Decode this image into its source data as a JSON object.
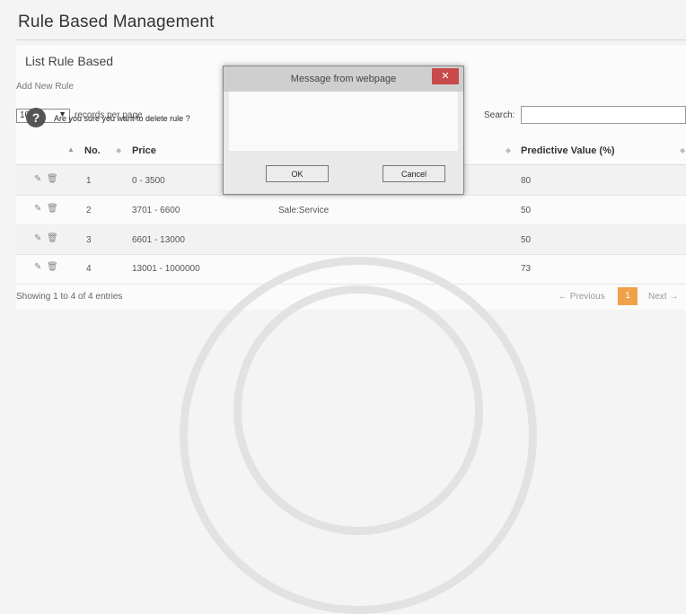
{
  "page": {
    "title": "Rule Based Management"
  },
  "panel": {
    "heading": "List Rule Based",
    "add_link": "Add New Rule"
  },
  "table_controls": {
    "length_value": "10",
    "length_label": "records per page",
    "search_label": "Search:"
  },
  "table": {
    "headers": {
      "no": "No.",
      "price": "Price",
      "predictive": "Predictive Value (%)"
    },
    "rows": [
      {
        "no": "1",
        "price": "0 - 3500",
        "rule": "",
        "predictive": "80"
      },
      {
        "no": "2",
        "price": "3701 - 6600",
        "rule": "Sale:Service",
        "predictive": "50"
      },
      {
        "no": "3",
        "price": "6601 - 13000",
        "rule": "",
        "predictive": "50"
      },
      {
        "no": "4",
        "price": "13001 - 1000000",
        "rule": "",
        "predictive": "73"
      }
    ]
  },
  "footer": {
    "info": "Showing 1 to 4 of 4 entries",
    "previous": "← Previous",
    "current_page": "1",
    "next": "Next →"
  },
  "dialog": {
    "title": "Message from webpage",
    "message": "Are you sure you want to delete rule ?",
    "ok_label": "OK",
    "cancel_label": "Cancel"
  },
  "icons": {
    "edit": "edit-icon",
    "delete": "delete-icon",
    "question": "question-icon",
    "close": "close-icon"
  }
}
